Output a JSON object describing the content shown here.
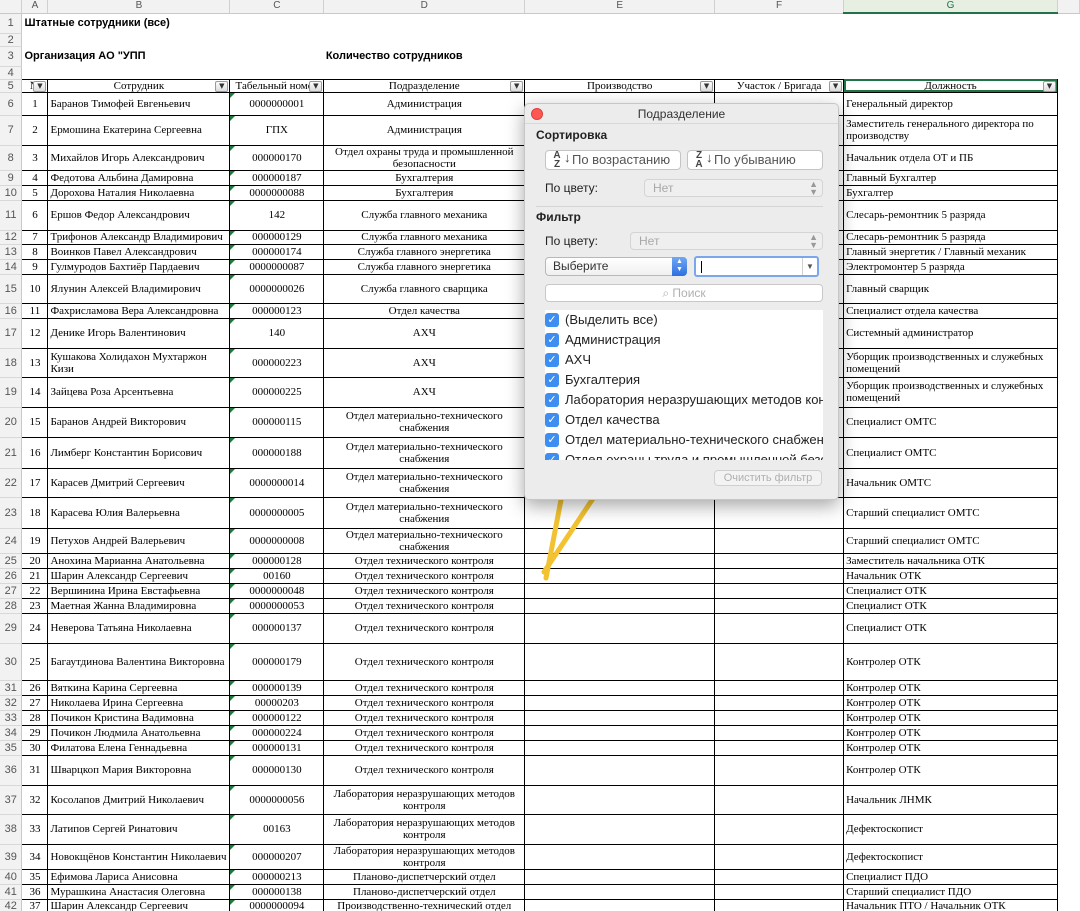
{
  "columns": [
    "A",
    "B",
    "C",
    "D",
    "E",
    "F",
    "G"
  ],
  "sheet": {
    "title": "Штатные сотрудники (все)",
    "org_label": "Организация  АО \"УПП",
    "count_label": "Количество сотрудников",
    "headers": [
      "№",
      "Сотрудник",
      "Табельный номер",
      "Подразделение",
      "Производство",
      "Участок / Бригада",
      "Должность"
    ]
  },
  "rows": [
    {
      "n": "1",
      "name": "Баранов Тимофей Евгеньевич",
      "tab": "0000000001",
      "dept": "Администрация",
      "pos": "Генеральный директор"
    },
    {
      "n": "2",
      "name": "Ермошина Екатерина Сергеевна",
      "tab": "ГПХ",
      "dept": "Администрация",
      "pos": "Заместитель генерального директора по производству"
    },
    {
      "n": "3",
      "name": "Михайлов Игорь Александрович",
      "tab": "000000170",
      "dept": "Отдел охраны труда и промышленной безопасности",
      "pos": "Начальник отдела ОТ и ПБ"
    },
    {
      "n": "4",
      "name": "Федотова Альбина Дамировна",
      "tab": "000000187",
      "dept": "Бухгалтерия",
      "pos": "Главный Бухгалтер"
    },
    {
      "n": "5",
      "name": "Дорохова Наталия Николаевна",
      "tab": "0000000088",
      "dept": "Бухгалтерия",
      "pos": "Бухгалтер"
    },
    {
      "n": "6",
      "name": "Ершов Федор Александрович",
      "tab": "142",
      "dept": "Служба главного механика",
      "pos": "Слесарь-ремонтник 5 разряда"
    },
    {
      "n": "7",
      "name": "Трифонов Александр Владимирович",
      "tab": "000000129",
      "dept": "Служба главного механика",
      "pos": "Слесарь-ремонтник 5 разряда"
    },
    {
      "n": "8",
      "name": "Воинков Павел Александрович",
      "tab": "000000174",
      "dept": "Служба главного энергетика",
      "pos": "Главный энергетик / Главный механик"
    },
    {
      "n": "9",
      "name": "Гулмуродов Бахтиёр Пардаевич",
      "tab": "0000000087",
      "dept": "Служба главного энергетика",
      "pos": "Электромонтер 5 разряда"
    },
    {
      "n": "10",
      "name": "Ялунин Алексей Владимирович",
      "tab": "0000000026",
      "dept": "Служба главного сварщика",
      "pos": "Главный сварщик"
    },
    {
      "n": "11",
      "name": "Фахрисламова Вера Александровна",
      "tab": "000000123",
      "dept": "Отдел качества",
      "pos": "Специалист отдела качества"
    },
    {
      "n": "12",
      "name": "Денике Игорь Валентинович",
      "tab": "140",
      "dept": "АХЧ",
      "pos": "Системный администратор"
    },
    {
      "n": "13",
      "name": "Кушакова Холидахон Мухтаржон Кизи",
      "tab": "000000223",
      "dept": "АХЧ",
      "pos": "Уборщик производственных и служебных помещений"
    },
    {
      "n": "14",
      "name": "Зайцева Роза Арсентьевна",
      "tab": "000000225",
      "dept": "АХЧ",
      "pos": "Уборщик производственных и служебных помещений"
    },
    {
      "n": "15",
      "name": "Баранов Андрей Викторович",
      "tab": "000000115",
      "dept": "Отдел материально-технического снабжения",
      "pos": "Специалист ОМТС"
    },
    {
      "n": "16",
      "name": "Лимберг Константин Борисович",
      "tab": "000000188",
      "dept": "Отдел материально-технического снабжения",
      "pos": "Специалист ОМТС"
    },
    {
      "n": "17",
      "name": "Карасев Дмитрий Сергеевич",
      "tab": "0000000014",
      "dept": "Отдел материально-технического снабжения",
      "pos": "Начальник ОМТС"
    },
    {
      "n": "18",
      "name": "Карасева Юлия Валерьевна",
      "tab": "0000000005",
      "dept": "Отдел материально-технического снабжения",
      "pos": "Старший специалист ОМТС"
    },
    {
      "n": "19",
      "name": "Петухов Андрей Валерьевич",
      "tab": "0000000008",
      "dept": "Отдел материально-технического снабжения",
      "pos": "Старший специалист ОМТС"
    },
    {
      "n": "20",
      "name": "Анохина Марианна Анатольевна",
      "tab": "000000128",
      "dept": "Отдел технического контроля",
      "pos": "Заместитель начальника ОТК"
    },
    {
      "n": "21",
      "name": "Шарин Александр Сергеевич",
      "tab": "00160",
      "dept": "Отдел технического контроля",
      "pos": "Начальник ОТК"
    },
    {
      "n": "22",
      "name": "Вершинина Ирина Евстафьевна",
      "tab": "0000000048",
      "dept": "Отдел технического контроля",
      "pos": "Специалист ОТК"
    },
    {
      "n": "23",
      "name": "Маетная Жанна Владимировна",
      "tab": "0000000053",
      "dept": "Отдел технического контроля",
      "pos": "Специалист ОТК"
    },
    {
      "n": "24",
      "name": "Неверова Татьяна Николаевна",
      "tab": "000000137",
      "dept": "Отдел технического контроля",
      "pos": "Специалист ОТК"
    },
    {
      "n": "25",
      "name": "Багаутдинова Валентина Викторовна",
      "tab": "000000179",
      "dept": "Отдел технического контроля",
      "pos": "Контролер ОТК"
    },
    {
      "n": "26",
      "name": "Вяткина Карина Сергеевна",
      "tab": "000000139",
      "dept": "Отдел технического контроля",
      "pos": "Контролер ОТК"
    },
    {
      "n": "27",
      "name": "Николаева Ирина Сергеевна",
      "tab": "00000203",
      "dept": "Отдел технического контроля",
      "pos": "Контролер ОТК"
    },
    {
      "n": "28",
      "name": "Почикон Кристина Вадимовна",
      "tab": "000000122",
      "dept": "Отдел технического контроля",
      "pos": "Контролер ОТК"
    },
    {
      "n": "29",
      "name": "Почикон Людмила Анатольевна",
      "tab": "000000224",
      "dept": "Отдел технического контроля",
      "pos": "Контролер ОТК"
    },
    {
      "n": "30",
      "name": "Филатова Елена Геннадьевна",
      "tab": "000000131",
      "dept": "Отдел технического контроля",
      "pos": "Контролер ОТК"
    },
    {
      "n": "31",
      "name": "Шварцкоп Мария Викторовна",
      "tab": "000000130",
      "dept": "Отдел технического контроля",
      "pos": "Контролер ОТК"
    },
    {
      "n": "32",
      "name": "Косолапов Дмитрий Николаевич",
      "tab": "0000000056",
      "dept": "Лаборатория неразрушающих методов контроля",
      "pos": "Начальник ЛНМК"
    },
    {
      "n": "33",
      "name": "Латипов Сергей Ринатович",
      "tab": "00163",
      "dept": "Лаборатория неразрушающих методов контроля",
      "pos": "Дефектоскопист"
    },
    {
      "n": "34",
      "name": "Новокщёнов Константин Николаевич",
      "tab": "000000207",
      "dept": "Лаборатория неразрушающих методов контроля",
      "pos": "Дефектоскопист"
    },
    {
      "n": "35",
      "name": "Ефимова Лариса Анисовна",
      "tab": "000000213",
      "dept": "Планово-диспетчерский отдел",
      "pos": "Специалист ПДО"
    },
    {
      "n": "36",
      "name": "Мурашкина Анастасия Олеговна",
      "tab": "000000138",
      "dept": "Планово-диспетчерский отдел",
      "pos": "Старший специалист ПДО"
    },
    {
      "n": "37",
      "name": "Шарин Александр Сергеевич",
      "tab": "0000000094",
      "dept": "Производственно-технический отдел",
      "pos": "Начальник ПТО / Начальник ОТК"
    }
  ],
  "popup": {
    "title": "Подразделение",
    "sort_heading": "Сортировка",
    "sort_asc": "По возрастанию",
    "sort_desc": "По убыванию",
    "by_color_label": "По цвету:",
    "color_value": "Нет",
    "filter_heading": "Фильтр",
    "filter_by_color_label": "По цвету:",
    "filter_color_value": "Нет",
    "condition_select": "Выберите",
    "search_placeholder": "Поиск",
    "items": [
      "(Выделить все)",
      "Администрация",
      "АХЧ",
      "Бухгалтерия",
      "Лаборатория неразрушающих методов контроля",
      "Отдел качества",
      "Отдел материально-технического снабжения",
      "Отдел охраны труда и промышленной безопасности"
    ],
    "clear_button": "Очистить фильтр"
  },
  "colors": {
    "accent_green": "#217346",
    "checkbox_blue": "#3d8ef0",
    "annotation_arrow": "#f2c230"
  }
}
